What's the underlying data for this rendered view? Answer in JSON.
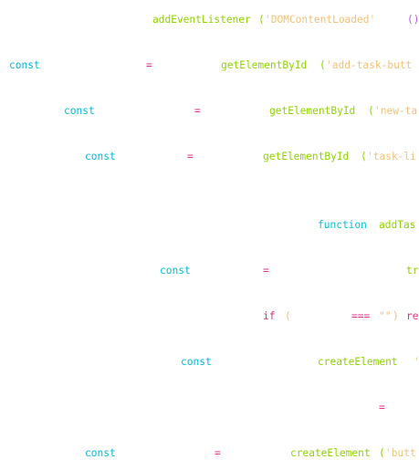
{
  "editor": {
    "colors": {
      "background": "#ffffff",
      "keyword": "#00b8d9",
      "function": "#8fd400",
      "operator": "#e0308a",
      "string": "#f2c27a",
      "punctuation": "#b060e0"
    },
    "lines": [
      {
        "tokens": {
          "fn": "addEventListener",
          "open": "(",
          "str": "'DOMContentLoaded'",
          "arrow": "()"
        }
      },
      {
        "tokens": {
          "kw": "const",
          "op": "=",
          "fn": "getElementById",
          "open": "(",
          "str": "'add-task-butt"
        }
      },
      {
        "tokens": {
          "kw": "const",
          "op": "=",
          "fn": "getElementById",
          "open": "(",
          "str": "'new-ta"
        }
      },
      {
        "tokens": {
          "kw": "const",
          "op": "=",
          "fn": "getElementById",
          "open": "(",
          "str": "'task-li"
        }
      },
      {
        "tokens": {
          "kw": "function",
          "fn": "addTas"
        }
      },
      {
        "tokens": {
          "kw": "const",
          "op": "=",
          "fn": "tr"
        }
      },
      {
        "tokens": {
          "kw": "if",
          "open": "(",
          "op": "===",
          "str": "\"\"",
          "close": ")",
          "ret": "re"
        }
      },
      {
        "tokens": {
          "kw": "const",
          "fn": "createElement",
          "str": "'"
        }
      },
      {
        "tokens": {
          "op": "="
        }
      },
      {
        "tokens": {
          "kw": "const",
          "op": "=",
          "fn": "createElement",
          "open": "(",
          "str": "'butt"
        }
      }
    ]
  }
}
